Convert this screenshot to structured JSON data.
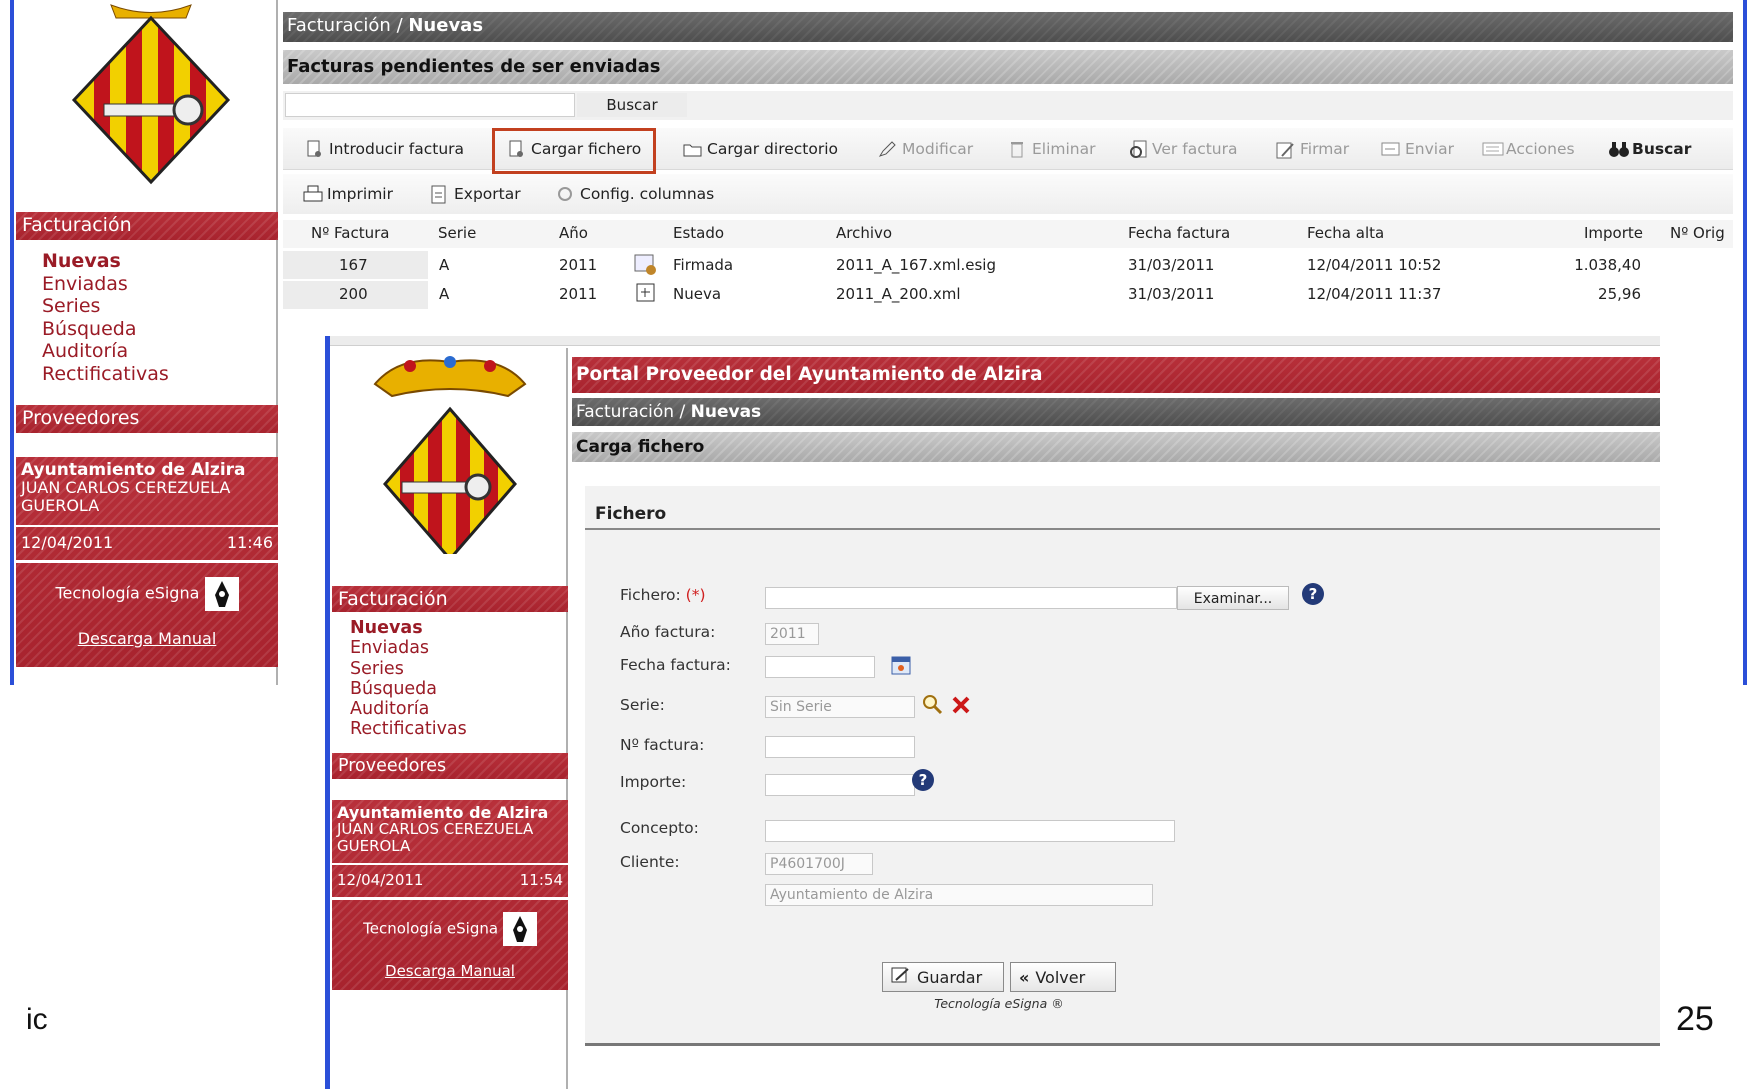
{
  "back": {
    "breadcrumb": {
      "section": "Facturación",
      "separator": " / ",
      "current": "Nuevas"
    },
    "subtitle": "Facturas pendientes de ser enviadas",
    "search": {
      "value": "",
      "button": "Buscar"
    },
    "toolbar1": [
      {
        "label": "Introducir factura",
        "icon": "new-invoice-icon",
        "enabled": true
      },
      {
        "label": "Cargar fichero",
        "icon": "upload-file-icon",
        "enabled": true,
        "highlighted": true
      },
      {
        "label": "Cargar directorio",
        "icon": "upload-folder-icon",
        "enabled": true
      },
      {
        "label": "Modificar",
        "icon": "edit-icon",
        "enabled": false
      },
      {
        "label": "Eliminar",
        "icon": "trash-icon",
        "enabled": false
      },
      {
        "label": "Ver factura",
        "icon": "view-icon",
        "enabled": false
      },
      {
        "label": "Firmar",
        "icon": "sign-icon",
        "enabled": false
      },
      {
        "label": "Enviar",
        "icon": "send-icon",
        "enabled": false
      },
      {
        "label": "Acciones",
        "icon": "actions-icon",
        "enabled": false
      },
      {
        "label": "Buscar",
        "icon": "binoculars-icon",
        "enabled": true
      }
    ],
    "toolbar2": [
      {
        "label": "Imprimir",
        "icon": "print-icon"
      },
      {
        "label": "Exportar",
        "icon": "export-icon"
      },
      {
        "label": "Config. columnas",
        "icon": "columns-config-icon"
      }
    ],
    "columns": [
      "Nº Factura",
      "Serie",
      "Año",
      "Estado",
      "Archivo",
      "Fecha factura",
      "Fecha alta",
      "Importe",
      "Nº Orig"
    ],
    "rows": [
      {
        "num": "167",
        "serie": "A",
        "anio": "2011",
        "estado": "Firmada",
        "archivo": "2011_A_167.xml.esig",
        "fecha": "31/03/2011",
        "alta": "12/04/2011 10:52",
        "importe": "1.038,40"
      },
      {
        "num": "200",
        "serie": "A",
        "anio": "2011",
        "estado": "Nueva",
        "archivo": "2011_A_200.xml",
        "fecha": "31/03/2011",
        "alta": "12/04/2011 11:37",
        "importe": "25,96"
      }
    ],
    "sidebar": {
      "section": "Facturación",
      "items": [
        "Nuevas",
        "Enviadas",
        "Series",
        "Búsqueda",
        "Auditoría",
        "Rectificativas"
      ],
      "providers": "Proveedores",
      "org": "Ayuntamiento de Alzira",
      "user": "JUAN CARLOS CEREZUELA GUEROLA",
      "date": "12/04/2011",
      "time": "11:46",
      "tech": "Tecnología eSigna",
      "download": "Descarga Manual"
    }
  },
  "front": {
    "portal_title": "Portal Proveedor del Ayuntamiento de Alzira",
    "breadcrumb": {
      "section": "Facturación",
      "separator": " / ",
      "current": "Nuevas"
    },
    "subtitle": "Carga fichero",
    "fieldset": "Fichero",
    "form": {
      "fichero_label": "Fichero:",
      "required_mark": "(*)",
      "browse": "Examinar...",
      "anio_label": "Año factura:",
      "anio_value": "2011",
      "fecha_label": "Fecha factura:",
      "serie_label": "Serie:",
      "serie_value": "Sin Serie",
      "num_label": "Nº factura:",
      "importe_label": "Importe:",
      "concepto_label": "Concepto:",
      "cliente_label": "Cliente:",
      "cliente_code": "P4601700J",
      "cliente_name": "Ayuntamiento de Alzira"
    },
    "buttons": {
      "save": "Guardar",
      "back": "Volver"
    },
    "footer": "Tecnología eSigna ®",
    "sidebar": {
      "section": "Facturación",
      "items": [
        "Nuevas",
        "Enviadas",
        "Series",
        "Búsqueda",
        "Auditoría",
        "Rectificativas"
      ],
      "providers": "Proveedores",
      "org": "Ayuntamiento de Alzira",
      "user": "JUAN CARLOS CEREZUELA GUEROLA",
      "date": "12/04/2011",
      "time": "11:54",
      "tech": "Tecnología eSigna",
      "download": "Descarga Manual"
    }
  },
  "slide": {
    "left_text": "ic",
    "page_number": "25"
  }
}
